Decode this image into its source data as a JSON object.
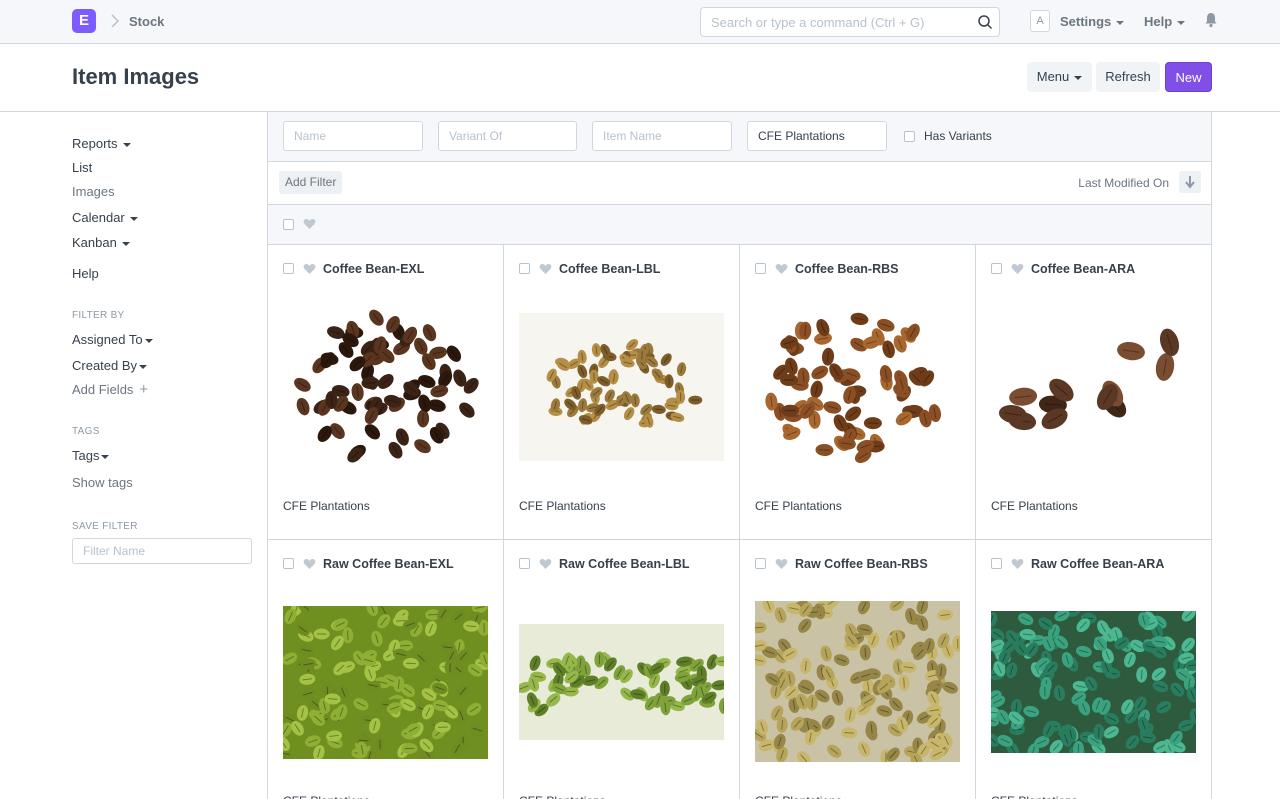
{
  "navbar": {
    "logo_letter": "E",
    "breadcrumb": "Stock",
    "search_placeholder": "Search or type a command (Ctrl + G)",
    "avatar_letter": "A",
    "settings_label": "Settings",
    "help_label": "Help"
  },
  "page": {
    "title": "Item Images",
    "menu_label": "Menu",
    "refresh_label": "Refresh",
    "new_label": "New"
  },
  "sidebar": {
    "reports": "Reports",
    "list": "List",
    "images": "Images",
    "calendar": "Calendar",
    "kanban": "Kanban",
    "help": "Help",
    "filter_by_heading": "FILTER BY",
    "assigned_to": "Assigned To",
    "created_by": "Created By",
    "add_fields": "Add Fields",
    "tags_heading": "TAGS",
    "tags": "Tags",
    "show_tags": "Show tags",
    "save_filter_heading": "SAVE FILTER",
    "filter_name_placeholder": "Filter Name"
  },
  "filters": {
    "name_placeholder": "Name",
    "variant_of_placeholder": "Variant Of",
    "item_name_placeholder": "Item Name",
    "item_group_value": "CFE Plantations",
    "has_variants_label": "Has Variants"
  },
  "sort": {
    "add_filter_label": "Add Filter",
    "sort_by_label": "Last Modified On"
  },
  "items": [
    {
      "title": "Coffee Bean-EXL",
      "group": "CFE Plantations"
    },
    {
      "title": "Coffee Bean-LBL",
      "group": "CFE Plantations"
    },
    {
      "title": "Coffee Bean-RBS",
      "group": "CFE Plantations"
    },
    {
      "title": "Coffee Bean-ARA",
      "group": "CFE Plantations"
    },
    {
      "title": "Raw Coffee Bean-EXL",
      "group": "CFE Plantations"
    },
    {
      "title": "Raw Coffee Bean-LBL",
      "group": "CFE Plantations"
    },
    {
      "title": "Raw Coffee Bean-RBS",
      "group": "CFE Plantations"
    },
    {
      "title": "Raw Coffee Bean-ARA",
      "group": "CFE Plantations"
    }
  ],
  "colors": {
    "primary": "#7f4fe8",
    "border": "#d1d8dd",
    "muted_text": "#6c7680"
  }
}
